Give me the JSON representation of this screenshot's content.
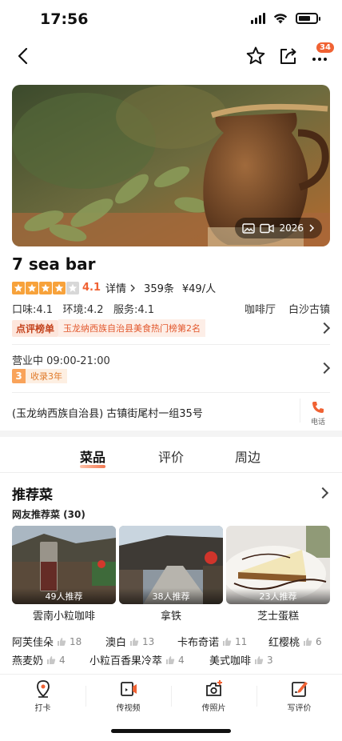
{
  "status": {
    "time": "17:56"
  },
  "nav": {
    "badge": "34"
  },
  "hero": {
    "media_count": "2026"
  },
  "shop": {
    "name": "7 sea bar",
    "rating_stars": 4.1,
    "score": "4.1",
    "details": "详情",
    "reviews": "359条",
    "price": "¥49/人",
    "taste": "口味:4.1",
    "env": "环境:4.2",
    "service": "服务:4.1",
    "category": "咖啡厅",
    "area": "白沙古镇",
    "rank_tag": "点评榜单",
    "rank_text": "玉龙纳西族自治县美食热门榜第2名",
    "hours": "营业中 09:00-21:00",
    "years_num": "3",
    "years_text": "收录3年",
    "address": "(玉龙纳西族自治县) 古镇街尾村一组35号",
    "phone_label": "电话"
  },
  "tabs": [
    {
      "label": "菜品"
    },
    {
      "label": "评价"
    },
    {
      "label": "周边"
    }
  ],
  "dishes": {
    "title": "推荐菜",
    "subtitle": "网友推荐菜 (30)",
    "items": [
      {
        "name": "雲南小粒咖啡",
        "count": "49人推荐"
      },
      {
        "name": "拿铁",
        "count": "38人推荐"
      },
      {
        "name": "芝士蛋糕",
        "count": "23人推荐"
      }
    ],
    "tags_row1": [
      {
        "name": "阿芙佳朵",
        "count": "18"
      },
      {
        "name": "澳白",
        "count": "13"
      },
      {
        "name": "卡布奇诺",
        "count": "11"
      },
      {
        "name": "红樱桃",
        "count": "6"
      }
    ],
    "tags_row2": [
      {
        "name": "燕麦奶",
        "count": "4"
      },
      {
        "name": "小粒百香果冷萃",
        "count": "4"
      },
      {
        "name": "美式咖啡",
        "count": "3"
      }
    ]
  },
  "bottom_bar": [
    {
      "label": "打卡",
      "icon": "location-icon"
    },
    {
      "label": "传视频",
      "icon": "video-upload-icon"
    },
    {
      "label": "传照片",
      "icon": "camera-upload-icon"
    },
    {
      "label": "写评价",
      "icon": "write-review-icon"
    }
  ],
  "colors": {
    "accent": "#f06233",
    "star": "#f7a23b"
  }
}
